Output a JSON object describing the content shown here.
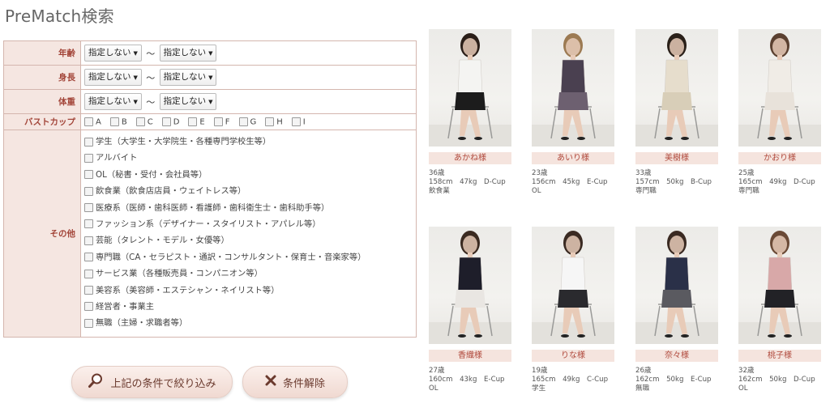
{
  "page": {
    "title": "PreMatch検索"
  },
  "filters": {
    "age": {
      "label": "年齢",
      "from": "指定しない",
      "to": "指定しない"
    },
    "height": {
      "label": "身長",
      "from": "指定しない",
      "to": "指定しない"
    },
    "weight": {
      "label": "体重",
      "from": "指定しない",
      "to": "指定しない"
    },
    "range_separator": "～",
    "bust": {
      "label": "バストカップ",
      "options": [
        "A",
        "B",
        "C",
        "D",
        "E",
        "F",
        "G",
        "H",
        "I"
      ]
    },
    "other": {
      "label": "その他",
      "options": [
        "学生（大学生・大学院生・各種専門学校生等）",
        "アルバイト",
        "OL（秘書・受付・会社員等）",
        "飲食業（飲食店店員・ウェイトレス等）",
        "医療系（医師・歯科医師・看護師・歯科衛生士・歯科助手等）",
        "ファッション系（デザイナー・スタイリスト・アパレル等）",
        "芸能（タレント・モデル・女優等）",
        "専門職（CA・セラピスト・通訳・コンサルタント・保育士・音楽家等）",
        "サービス業（各種販売員・コンパニオン等）",
        "美容系（美容師・エステシャン・ネイリスト等）",
        "経営者・事業主",
        "無職（主婦・求職者等）"
      ]
    }
  },
  "buttons": {
    "search": "上記の条件で絞り込み",
    "reset": "条件解除"
  },
  "profiles": [
    {
      "name": "あかね様",
      "age": "36歳",
      "stats": "158cm　47kg　D-Cup",
      "job": "飲食業",
      "top": "#f4f4f2",
      "bottom": "#1c1c1c",
      "hair": "#2a1e18"
    },
    {
      "name": "あいり様",
      "age": "23歳",
      "stats": "156cm　45kg　E-Cup",
      "job": "OL",
      "top": "#4a4050",
      "bottom": "#6d6070",
      "hair": "#9c7a52"
    },
    {
      "name": "美樹様",
      "age": "33歳",
      "stats": "157cm　50kg　B-Cup",
      "job": "専門職",
      "top": "#e6ddcc",
      "bottom": "#d8ceb8",
      "hair": "#2a2019"
    },
    {
      "name": "かおり様",
      "age": "25歳",
      "stats": "165cm　49kg　D-Cup",
      "job": "専門職",
      "top": "#f0ece6",
      "bottom": "#e8e2da",
      "hair": "#5a4030"
    },
    {
      "name": "香織様",
      "age": "27歳",
      "stats": "160cm　43kg　E-Cup",
      "job": "OL",
      "top": "#1e1e2a",
      "bottom": "#e9e6e2",
      "hair": "#3a2a20"
    },
    {
      "name": "りな様",
      "age": "19歳",
      "stats": "165cm　49kg　C-Cup",
      "job": "学生",
      "top": "#f6f6f6",
      "bottom": "#2a2a2e",
      "hair": "#3a2a22"
    },
    {
      "name": "奈々様",
      "age": "26歳",
      "stats": "162cm　50kg　E-Cup",
      "job": "無職",
      "top": "#2a3048",
      "bottom": "#5a5a60",
      "hair": "#3a2a22"
    },
    {
      "name": "桃子様",
      "age": "32歳",
      "stats": "162cm　50kg　D-Cup",
      "job": "OL",
      "top": "#d8a8a8",
      "bottom": "#222226",
      "hair": "#6a4a36"
    }
  ]
}
